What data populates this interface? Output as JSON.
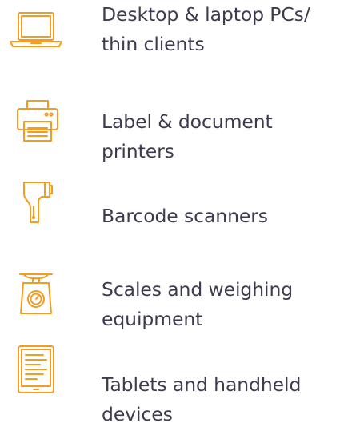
{
  "accent_color": "#f39c1f",
  "text_color": "#3d3b4f",
  "items": [
    {
      "icon": "laptop-icon",
      "label": "Desktop & laptop PCs/\nthin clients"
    },
    {
      "icon": "printer-icon",
      "label": "Label & document\nprinters"
    },
    {
      "icon": "barcode-scanner-icon",
      "label": "Barcode scanners"
    },
    {
      "icon": "weighing-scale-icon",
      "label": "Scales and weighing\nequipment"
    },
    {
      "icon": "tablet-icon",
      "label": "Tablets and handheld\ndevices"
    }
  ]
}
